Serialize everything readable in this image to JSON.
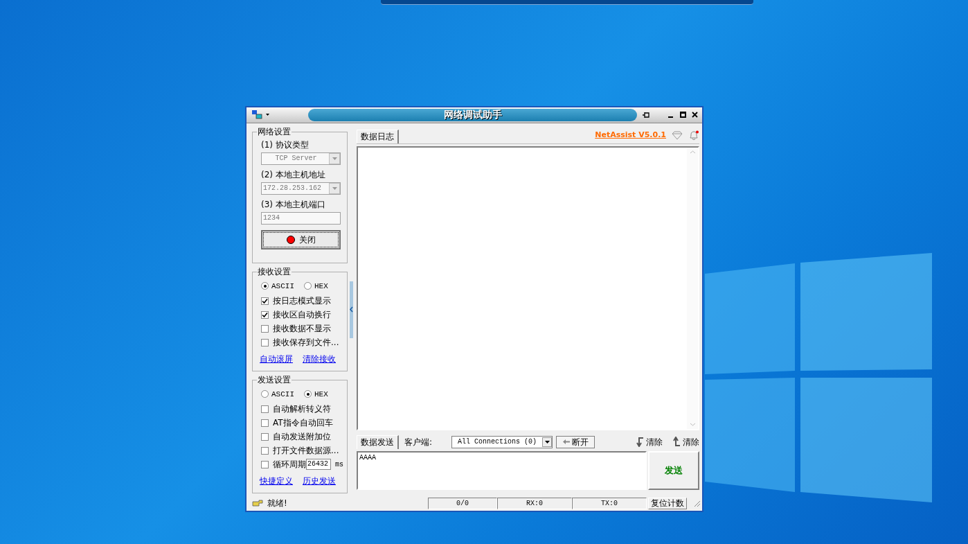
{
  "window": {
    "title": "网络调试助手"
  },
  "network_settings": {
    "title": "网络设置",
    "fields": [
      {
        "kind": "select",
        "label": "(1) 协议类型",
        "value": "TCP Server",
        "disabled": true
      },
      {
        "kind": "select",
        "label": "(2) 本地主机地址",
        "value": "172.28.253.162",
        "disabled": true
      },
      {
        "kind": "input",
        "label": "(3) 本地主机端口",
        "value": "1234",
        "disabled": true
      }
    ],
    "connect_button": {
      "label": "关闭",
      "connected": true
    }
  },
  "receive_settings": {
    "title": "接收设置",
    "modes": [
      {
        "label": "ASCII",
        "selected": true
      },
      {
        "label": "HEX",
        "selected": false
      }
    ],
    "options": [
      {
        "kind": "checkbox",
        "label": "按日志模式显示",
        "checked": true
      },
      {
        "kind": "checkbox",
        "label": "接收区自动换行",
        "checked": true
      },
      {
        "kind": "checkbox",
        "label": "接收数据不显示",
        "checked": false
      },
      {
        "kind": "checkbox",
        "label": "接收保存到文件...",
        "checked": false
      }
    ],
    "links": [
      "自动滚屏",
      "清除接收"
    ]
  },
  "send_settings": {
    "title": "发送设置",
    "modes": [
      {
        "label": "ASCII",
        "selected": false
      },
      {
        "label": "HEX",
        "selected": true
      }
    ],
    "options": [
      {
        "kind": "checkbox",
        "label": "自动解析转义符",
        "checked": false
      },
      {
        "kind": "checkbox",
        "label": "AT指令自动回车",
        "checked": false
      },
      {
        "kind": "checkbox",
        "label": "自动发送附加位",
        "checked": false
      },
      {
        "kind": "checkbox",
        "label": "打开文件数据源...",
        "checked": false
      },
      {
        "kind": "period",
        "label": "循环周期",
        "checked": false,
        "value": "26432",
        "unit": "ms"
      }
    ],
    "links": [
      "快捷定义",
      "历史发送"
    ]
  },
  "log_panel": {
    "tab": "数据日志",
    "version_link": "NetAssist V5.0.1"
  },
  "send_panel": {
    "tab": "数据发送",
    "client_label": "客户端:",
    "client_select": "All Connections (0)",
    "disconnect_button": "断开",
    "clear_buttons": [
      {
        "kind": "down",
        "label": "清除"
      },
      {
        "kind": "up",
        "label": "清除"
      }
    ],
    "text": "AAAA",
    "send_button": "发送"
  },
  "status_bar": {
    "message": "就绪!",
    "counts": [
      "0/0",
      "RX:0",
      "TX:0"
    ],
    "reset_button": "复位计数"
  }
}
